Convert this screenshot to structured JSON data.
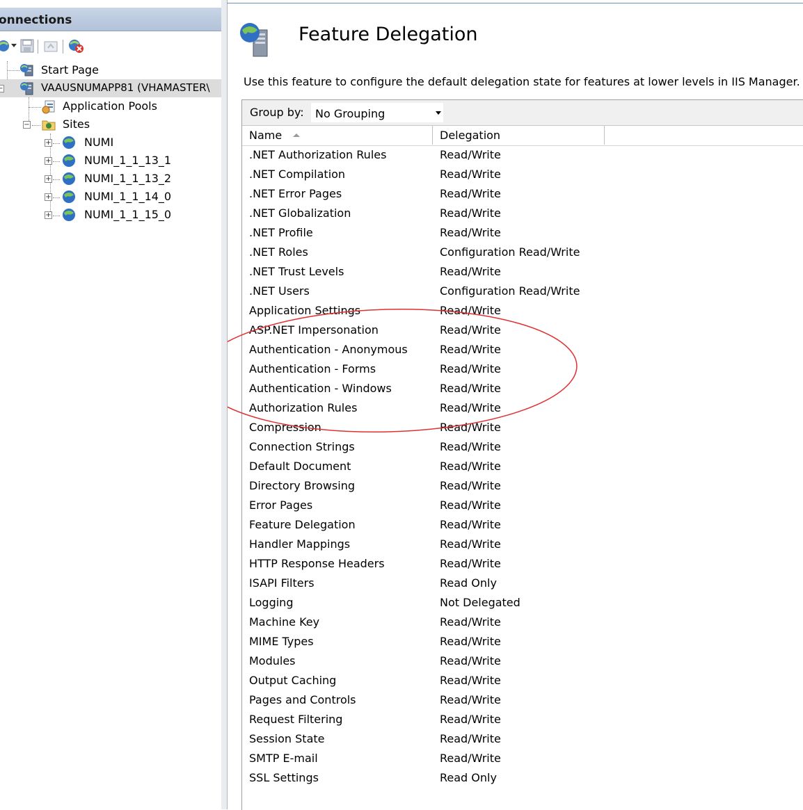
{
  "connections": {
    "header": "onnections",
    "toolbar": [
      "connect-icon",
      "save-icon",
      "up-level-icon",
      "disconnect-icon"
    ],
    "tree": [
      {
        "label": "Start Page"
      },
      {
        "label": "VAAUSNUMAPP81 (VHAMASTER\\"
      },
      {
        "label": "Application Pools"
      },
      {
        "label": "Sites"
      },
      {
        "label": "NUMI"
      },
      {
        "label": "NUMI_1_1_13_1"
      },
      {
        "label": "NUMI_1_1_13_2"
      },
      {
        "label": "NUMI_1_1_14_0"
      },
      {
        "label": "NUMI_1_1_15_0"
      }
    ]
  },
  "main": {
    "title": "Feature Delegation",
    "description": "Use this feature to configure the default delegation state for features at lower levels in IIS Manager.",
    "group_by_label": "Group by:",
    "group_by_value": "No Grouping",
    "columns": {
      "name": "Name",
      "delegation": "Delegation"
    },
    "rows": [
      {
        "name": ".NET Authorization Rules",
        "delegation": "Read/Write"
      },
      {
        "name": ".NET Compilation",
        "delegation": "Read/Write"
      },
      {
        "name": ".NET Error Pages",
        "delegation": "Read/Write"
      },
      {
        "name": ".NET Globalization",
        "delegation": "Read/Write"
      },
      {
        "name": ".NET Profile",
        "delegation": "Read/Write"
      },
      {
        "name": ".NET Roles",
        "delegation": "Configuration Read/Write"
      },
      {
        "name": ".NET Trust Levels",
        "delegation": "Read/Write"
      },
      {
        "name": ".NET Users",
        "delegation": "Configuration Read/Write"
      },
      {
        "name": "Application Settings",
        "delegation": "Read/Write"
      },
      {
        "name": "ASP.NET Impersonation",
        "delegation": "Read/Write"
      },
      {
        "name": "Authentication - Anonymous",
        "delegation": "Read/Write"
      },
      {
        "name": "Authentication - Forms",
        "delegation": "Read/Write"
      },
      {
        "name": "Authentication - Windows",
        "delegation": "Read/Write"
      },
      {
        "name": "Authorization Rules",
        "delegation": "Read/Write"
      },
      {
        "name": "Compression",
        "delegation": "Read/Write"
      },
      {
        "name": "Connection Strings",
        "delegation": "Read/Write"
      },
      {
        "name": "Default Document",
        "delegation": "Read/Write"
      },
      {
        "name": "Directory Browsing",
        "delegation": "Read/Write"
      },
      {
        "name": "Error Pages",
        "delegation": "Read/Write"
      },
      {
        "name": "Feature Delegation",
        "delegation": "Read/Write"
      },
      {
        "name": "Handler Mappings",
        "delegation": "Read/Write"
      },
      {
        "name": "HTTP Response Headers",
        "delegation": "Read/Write"
      },
      {
        "name": "ISAPI Filters",
        "delegation": "Read Only"
      },
      {
        "name": "Logging",
        "delegation": "Not Delegated"
      },
      {
        "name": "Machine Key",
        "delegation": "Read/Write"
      },
      {
        "name": "MIME Types",
        "delegation": "Read/Write"
      },
      {
        "name": "Modules",
        "delegation": "Read/Write"
      },
      {
        "name": "Output Caching",
        "delegation": "Read/Write"
      },
      {
        "name": "Pages and Controls",
        "delegation": "Read/Write"
      },
      {
        "name": "Request Filtering",
        "delegation": "Read/Write"
      },
      {
        "name": "Session State",
        "delegation": "Read/Write"
      },
      {
        "name": "SMTP E-mail",
        "delegation": "Read/Write"
      },
      {
        "name": "SSL Settings",
        "delegation": "Read Only"
      }
    ]
  },
  "colors": {
    "annotation_ellipse": "#e03030",
    "header_bg": "#b9c8dc",
    "selection": "#dcdcdc"
  }
}
